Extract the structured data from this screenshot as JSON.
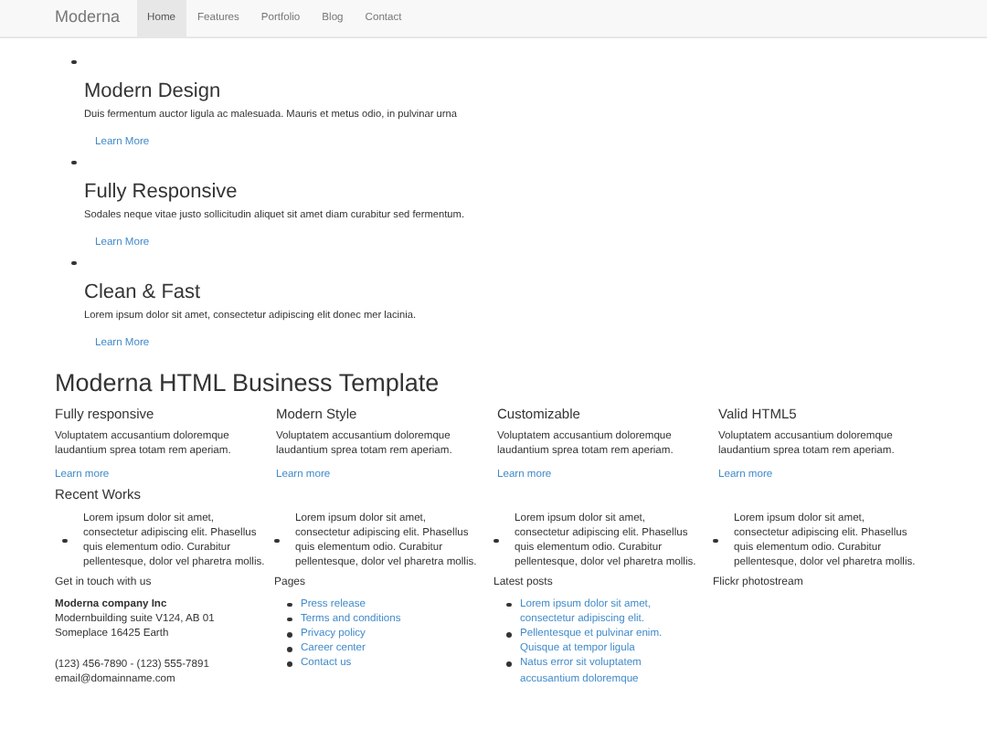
{
  "nav": {
    "brand": "Moderna",
    "items": [
      {
        "label": "Home",
        "selected": true
      },
      {
        "label": "Features",
        "selected": false
      },
      {
        "label": "Portfolio",
        "selected": false
      },
      {
        "label": "Blog",
        "selected": false
      },
      {
        "label": "Contact",
        "selected": false
      }
    ]
  },
  "features": [
    {
      "title": "Modern Design",
      "text": "Duis fermentum auctor ligula ac malesuada. Mauris et metus odio, in pulvinar urna",
      "link": "Learn More"
    },
    {
      "title": "Fully Responsive",
      "text": "Sodales neque vitae justo sollicitudin aliquet sit amet diam curabitur sed fermentum.",
      "link": "Learn More"
    },
    {
      "title": "Clean & Fast",
      "text": "Lorem ipsum dolor sit amet, consectetur adipiscing elit donec mer lacinia.",
      "link": "Learn More"
    }
  ],
  "main_heading": "Moderna HTML Business Template",
  "columns": [
    {
      "title": "Fully responsive",
      "text": "Voluptatem accusantium doloremque laudantium sprea totam rem aperiam.",
      "link": "Learn more"
    },
    {
      "title": "Modern Style",
      "text": "Voluptatem accusantium doloremque laudantium sprea totam rem aperiam.",
      "link": "Learn more"
    },
    {
      "title": "Customizable",
      "text": "Voluptatem accusantium doloremque laudantium sprea totam rem aperiam.",
      "link": "Learn more"
    },
    {
      "title": "Valid HTML5",
      "text": "Voluptatem accusantium doloremque laudantium sprea totam rem aperiam.",
      "link": "Learn more"
    }
  ],
  "recent_works": {
    "title": "Recent Works",
    "items": [
      "Lorem ipsum dolor sit amet, consectetur adipiscing elit. Phasellus quis elementum odio. Curabitur pellentesque, dolor vel pharetra mollis.",
      "Lorem ipsum dolor sit amet, consectetur adipiscing elit. Phasellus quis elementum odio. Curabitur pellentesque, dolor vel pharetra mollis.",
      "Lorem ipsum dolor sit amet, consectetur adipiscing elit. Phasellus quis elementum odio. Curabitur pellentesque, dolor vel pharetra mollis.",
      "Lorem ipsum dolor sit amet, consectetur adipiscing elit. Phasellus quis elementum odio. Curabitur pellentesque, dolor vel pharetra mollis."
    ]
  },
  "footer": {
    "contact": {
      "title": "Get in touch with us",
      "company": "Moderna company Inc",
      "address": [
        "Modernbuilding suite V124, AB 01",
        "Someplace 16425 Earth"
      ],
      "details": [
        "(123) 456-7890 - (123) 555-7891",
        "email@domainname.com"
      ]
    },
    "pages": {
      "title": "Pages",
      "links": [
        "Press release",
        "Terms and conditions",
        "Privacy policy",
        "Career center",
        "Contact us"
      ]
    },
    "latest_posts": {
      "title": "Latest posts",
      "links": [
        "Lorem ipsum dolor sit amet, consectetur adipiscing elit.",
        "Pellentesque et pulvinar enim. Quisque at tempor ligula",
        "Natus error sit voluptatem accusantium doloremque"
      ]
    },
    "flickr": {
      "title": "Flickr photostream"
    }
  }
}
